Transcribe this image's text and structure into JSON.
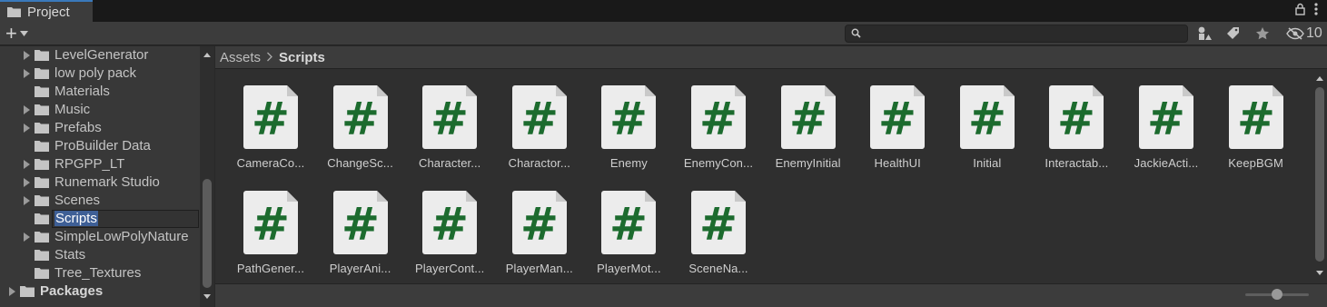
{
  "tab": {
    "title": "Project"
  },
  "toolbar": {
    "create_symbol": "+",
    "search_placeholder": "",
    "hidden_count": "10"
  },
  "tree": {
    "items": [
      {
        "label": "LevelGenerator",
        "expandable": true,
        "depth": 1
      },
      {
        "label": "low poly pack",
        "expandable": true,
        "depth": 1
      },
      {
        "label": "Materials",
        "expandable": false,
        "depth": 1
      },
      {
        "label": "Music",
        "expandable": true,
        "depth": 1
      },
      {
        "label": "Prefabs",
        "expandable": true,
        "depth": 1
      },
      {
        "label": "ProBuilder Data",
        "expandable": false,
        "depth": 1
      },
      {
        "label": "RPGPP_LT",
        "expandable": true,
        "depth": 1
      },
      {
        "label": "Runemark Studio",
        "expandable": true,
        "depth": 1
      },
      {
        "label": "Scenes",
        "expandable": true,
        "depth": 1
      },
      {
        "label": "Scripts",
        "expandable": false,
        "depth": 1,
        "selected": true
      },
      {
        "label": "SimpleLowPolyNature",
        "expandable": true,
        "depth": 1
      },
      {
        "label": "Stats",
        "expandable": false,
        "depth": 1
      },
      {
        "label": "Tree_Textures",
        "expandable": false,
        "depth": 1
      },
      {
        "label": "Packages",
        "expandable": true,
        "depth": 0
      }
    ]
  },
  "breadcrumb": {
    "root": "Assets",
    "separator": "›",
    "current": "Scripts"
  },
  "assets": [
    {
      "name": "CameraCo...",
      "glyph": "#"
    },
    {
      "name": "ChangeSc...",
      "glyph": "#"
    },
    {
      "name": "Character...",
      "glyph": "#"
    },
    {
      "name": "Charactor...",
      "glyph": "#"
    },
    {
      "name": "Enemy",
      "glyph": "#"
    },
    {
      "name": "EnemyCon...",
      "glyph": "#"
    },
    {
      "name": "EnemyInitial",
      "glyph": "#"
    },
    {
      "name": "HealthUI",
      "glyph": "#"
    },
    {
      "name": "Initial",
      "glyph": "#"
    },
    {
      "name": "Interactab...",
      "glyph": "#"
    },
    {
      "name": "JackieActi...",
      "glyph": "#"
    },
    {
      "name": "KeepBGM",
      "glyph": "#"
    },
    {
      "name": "PathGener...",
      "glyph": "#"
    },
    {
      "name": "PlayerAni...",
      "glyph": "#"
    },
    {
      "name": "PlayerCont...",
      "glyph": "#"
    },
    {
      "name": "PlayerMan...",
      "glyph": "#"
    },
    {
      "name": "PlayerMot...",
      "glyph": "#"
    },
    {
      "name": "SceneNa...",
      "glyph": "#"
    }
  ],
  "icon_size_slider": {
    "value": 0.5
  },
  "colors": {
    "accent": "#3a79bb",
    "selection": "#3e5f96",
    "script_hash": "#1c6b2e",
    "doc_bg": "#ececec"
  }
}
